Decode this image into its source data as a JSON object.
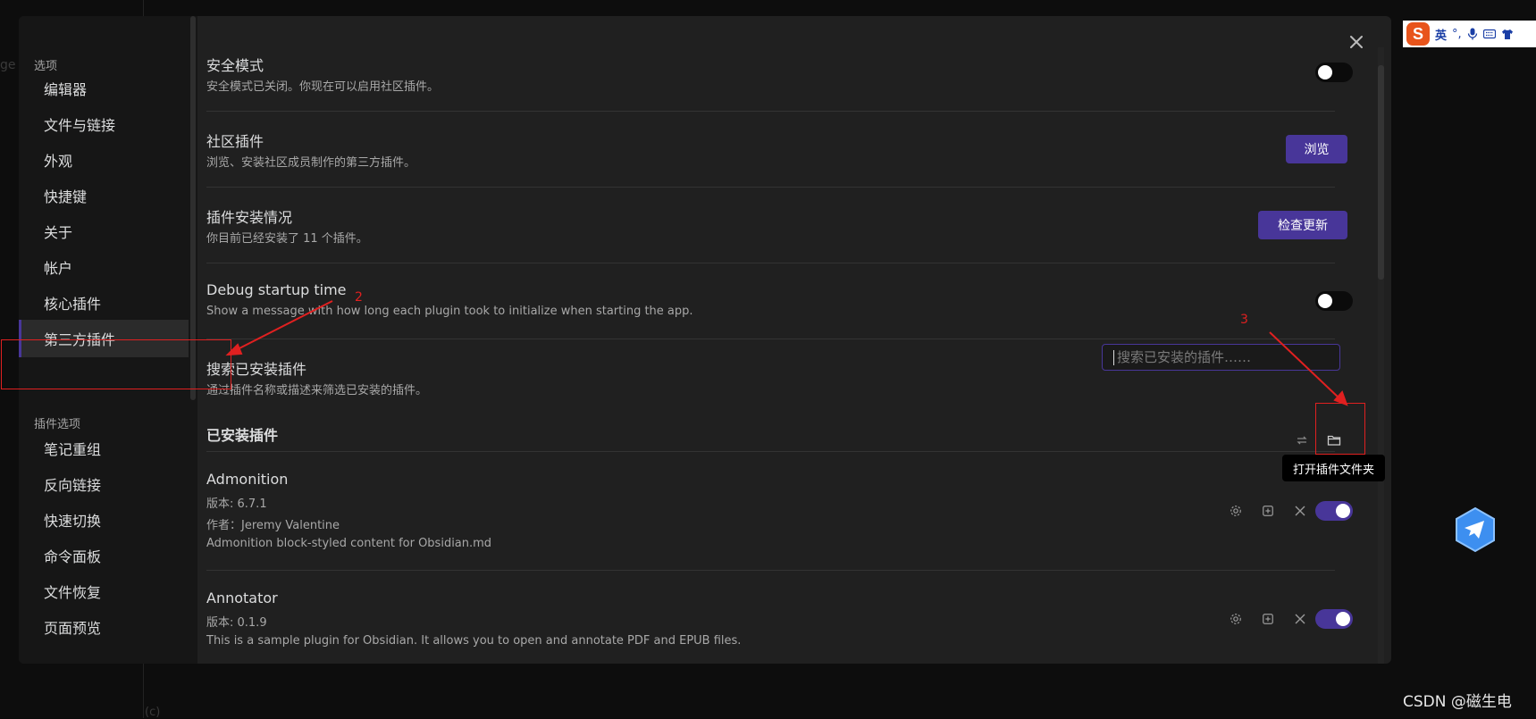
{
  "background": {
    "faint_text": "ge 2",
    "faint_text2": "(c)"
  },
  "sidebar": {
    "options_heading": "选项",
    "items": [
      "编辑器",
      "文件与链接",
      "外观",
      "快捷键",
      "关于",
      "帐户",
      "核心插件",
      "第三方插件"
    ],
    "active_index": 7,
    "plugin_options_heading": "插件选项",
    "plugin_items": [
      "笔记重组",
      "反向链接",
      "快速切换",
      "命令面板",
      "文件恢复",
      "页面预览"
    ]
  },
  "settings": {
    "safe_mode": {
      "name": "安全模式",
      "desc": "安全模式已关闭。你现在可以启用社区插件。",
      "toggle_on": false
    },
    "community": {
      "name": "社区插件",
      "desc": "浏览、安装社区成员制作的第三方插件。",
      "button": "浏览"
    },
    "install_status": {
      "name": "插件安装情况",
      "desc": "你目前已经安装了 11 个插件。",
      "button": "检查更新"
    },
    "debug": {
      "name": "Debug startup time",
      "desc": "Show a message with how long each plugin took to initialize when starting the app.",
      "toggle_on": false
    },
    "search": {
      "name": "搜索已安装插件",
      "desc": "通过插件名称或描述来筛选已安装的插件。",
      "placeholder": "搜索已安装的插件……"
    }
  },
  "installed": {
    "title": "已安装插件",
    "icons": [
      "reload-icon",
      "folder-icon"
    ],
    "tooltip": "打开插件文件夹",
    "plugins": [
      {
        "name": "Admonition",
        "version": "版本: 6.7.1",
        "author": "作者：Jeremy Valentine",
        "desc": "Admonition block-styled content for Obsidian.md",
        "enabled": true
      },
      {
        "name": "Annotator",
        "version": "版本: 0.1.9",
        "author": "",
        "desc": "This is a sample plugin for Obsidian. It allows you to open and annotate PDF and EPUB files.",
        "enabled": true
      }
    ]
  },
  "annotations": {
    "label_2": "2",
    "label_3": "3",
    "color": "#e02020"
  },
  "accent_color": "#483699",
  "ime": {
    "logo": "S",
    "lang": "英",
    "punct": "°,",
    "icons": [
      "microphone-icon",
      "keyboard-icon",
      "shirt-icon"
    ]
  },
  "watermark": "CSDN @磁生电"
}
